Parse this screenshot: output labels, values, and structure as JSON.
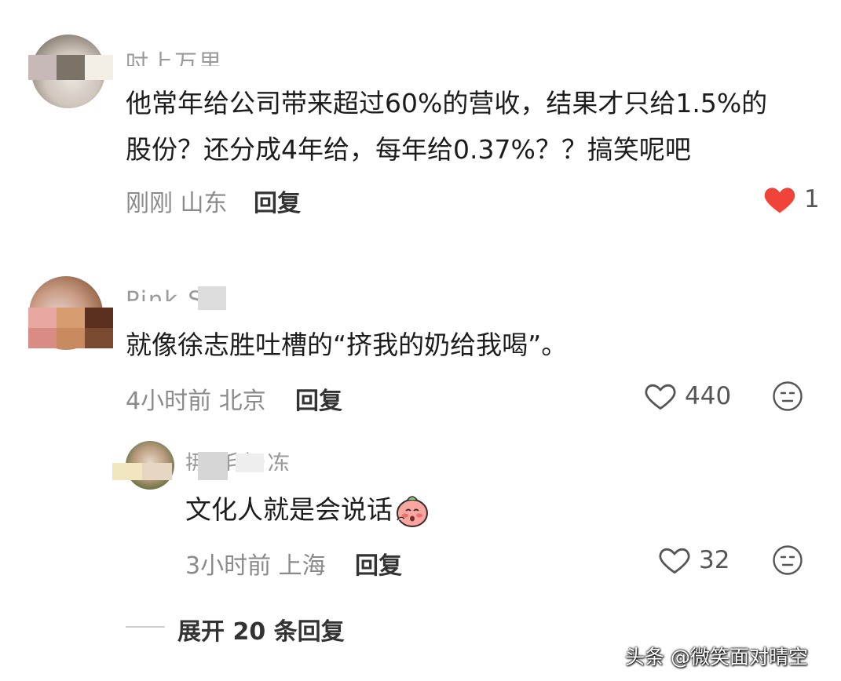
{
  "comments": [
    {
      "username_partial": "吋上万里",
      "text": "他常年给公司带来超过60%的营收，结果才只给1.5%的股份？还分成4年给，每年给0.37%？？搞笑呢吧",
      "line1": "他常年给公司带来超过60%的营收，结果才只给1.5%的",
      "line2": "股份？还分成4年给，每年给0.37%？？搞笑呢吧",
      "time": "刚刚",
      "location": "山东",
      "reply_label": "回复",
      "likes": "1",
      "liked": true
    },
    {
      "username_partial": "Pink S",
      "text": "就像徐志胜吐槽的“挤我的奶给我喝”。",
      "time": "4小时前",
      "location": "北京",
      "reply_label": "回复",
      "likes": "440",
      "liked": false,
      "replies": [
        {
          "username_partial": "挪 毛奶冻",
          "text": "文化人就是会说话",
          "emoji": "shy-peach-emoji",
          "time": "3小时前",
          "location": "上海",
          "reply_label": "回复",
          "likes": "32",
          "liked": false
        }
      ],
      "expand_label": "展开 20 条回复"
    }
  ],
  "watermark": "头条 @微笑面对晴空",
  "colors": {
    "like_red": "#f0443a",
    "meta_gray": "#8a8a8a",
    "text": "#1c1c1c"
  }
}
